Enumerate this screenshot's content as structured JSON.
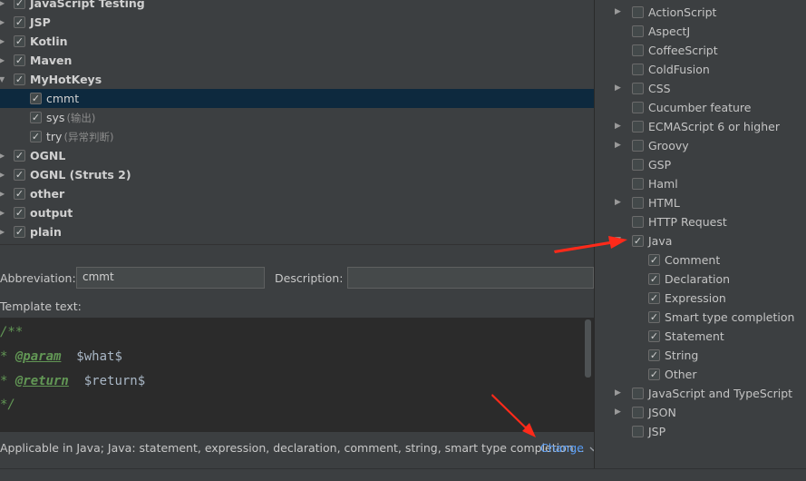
{
  "tree": {
    "items": [
      {
        "label": "JavaScript Testing",
        "checked": true,
        "bold": true,
        "level": 0,
        "expandable": true,
        "sub": ""
      },
      {
        "label": "JSP",
        "checked": true,
        "bold": true,
        "level": 0,
        "expandable": true,
        "sub": ""
      },
      {
        "label": "Kotlin",
        "checked": true,
        "bold": true,
        "level": 0,
        "expandable": true,
        "sub": ""
      },
      {
        "label": "Maven",
        "checked": true,
        "bold": true,
        "level": 0,
        "expandable": true,
        "sub": ""
      },
      {
        "label": "MyHotKeys",
        "checked": true,
        "bold": true,
        "level": 0,
        "expandable": true,
        "expanded": true,
        "sub": ""
      },
      {
        "label": "cmmt",
        "checked": true,
        "bold": false,
        "level": 1,
        "expandable": false,
        "selected": true,
        "sub": ""
      },
      {
        "label": "sys",
        "checked": true,
        "bold": false,
        "level": 1,
        "expandable": false,
        "sub": "(输出)"
      },
      {
        "label": "try",
        "checked": true,
        "bold": false,
        "level": 1,
        "expandable": false,
        "sub": "(异常判断)"
      },
      {
        "label": "OGNL",
        "checked": true,
        "bold": true,
        "level": 0,
        "expandable": true,
        "sub": ""
      },
      {
        "label": "OGNL (Struts 2)",
        "checked": true,
        "bold": true,
        "level": 0,
        "expandable": true,
        "sub": ""
      },
      {
        "label": "other",
        "checked": true,
        "bold": true,
        "level": 0,
        "expandable": true,
        "sub": ""
      },
      {
        "label": "output",
        "checked": true,
        "bold": true,
        "level": 0,
        "expandable": true,
        "sub": ""
      },
      {
        "label": "plain",
        "checked": true,
        "bold": true,
        "level": 0,
        "expandable": true,
        "sub": ""
      }
    ]
  },
  "form": {
    "abbreviation_label": "Abbreviation:",
    "abbreviation_value": "cmmt",
    "description_label": "Description:",
    "description_value": "",
    "template_label": "Template text:"
  },
  "editor": {
    "lines": [
      [
        {
          "t": "/**",
          "c": "cmt"
        }
      ],
      [
        {
          "t": "* ",
          "c": "cmt"
        },
        {
          "t": "@param",
          "c": "tag"
        },
        {
          "t": "  $what$",
          "c": "var"
        }
      ],
      [
        {
          "t": "* ",
          "c": "cmt"
        },
        {
          "t": "@return",
          "c": "tag"
        },
        {
          "t": "  $return$",
          "c": "var"
        }
      ],
      [
        {
          "t": "*/",
          "c": "cmt"
        }
      ]
    ]
  },
  "footer": {
    "applicable_text": "Applicable in Java; Java: statement, expression, declaration, comment, string, smart type completion...",
    "change_label": "Change",
    "change_icon": "chevron-down-icon"
  },
  "context_popup": {
    "items": [
      {
        "label": "ActionScript",
        "checked": false,
        "level": 0,
        "expandable": true
      },
      {
        "label": "AspectJ",
        "checked": false,
        "level": 0,
        "expandable": false
      },
      {
        "label": "CoffeeScript",
        "checked": false,
        "level": 0,
        "expandable": false
      },
      {
        "label": "ColdFusion",
        "checked": false,
        "level": 0,
        "expandable": false
      },
      {
        "label": "CSS",
        "checked": false,
        "level": 0,
        "expandable": true
      },
      {
        "label": "Cucumber feature",
        "checked": false,
        "level": 0,
        "expandable": false
      },
      {
        "label": "ECMAScript 6 or higher",
        "checked": false,
        "level": 0,
        "expandable": true
      },
      {
        "label": "Groovy",
        "checked": false,
        "level": 0,
        "expandable": true
      },
      {
        "label": "GSP",
        "checked": false,
        "level": 0,
        "expandable": false
      },
      {
        "label": "Haml",
        "checked": false,
        "level": 0,
        "expandable": false
      },
      {
        "label": "HTML",
        "checked": false,
        "level": 0,
        "expandable": true
      },
      {
        "label": "HTTP Request",
        "checked": false,
        "level": 0,
        "expandable": false
      },
      {
        "label": "Java",
        "checked": true,
        "level": 0,
        "expandable": true,
        "expanded": true
      },
      {
        "label": "Comment",
        "checked": true,
        "level": 1,
        "expandable": false
      },
      {
        "label": "Declaration",
        "checked": true,
        "level": 1,
        "expandable": false
      },
      {
        "label": "Expression",
        "checked": true,
        "level": 1,
        "expandable": false
      },
      {
        "label": "Smart type completion",
        "checked": true,
        "level": 1,
        "expandable": false
      },
      {
        "label": "Statement",
        "checked": true,
        "level": 1,
        "expandable": false
      },
      {
        "label": "String",
        "checked": true,
        "level": 1,
        "expandable": false
      },
      {
        "label": "Other",
        "checked": true,
        "level": 1,
        "expandable": false
      },
      {
        "label": "JavaScript and TypeScript",
        "checked": false,
        "level": 0,
        "expandable": true
      },
      {
        "label": "JSON",
        "checked": false,
        "level": 0,
        "expandable": true
      },
      {
        "label": "JSP",
        "checked": false,
        "level": 0,
        "expandable": false
      }
    ]
  },
  "colors": {
    "background": "#3c3f41",
    "selection": "#0d293e",
    "editor_bg": "#2b2b2b",
    "link": "#589df6",
    "annotation_arrow": "#ff2a1a"
  }
}
